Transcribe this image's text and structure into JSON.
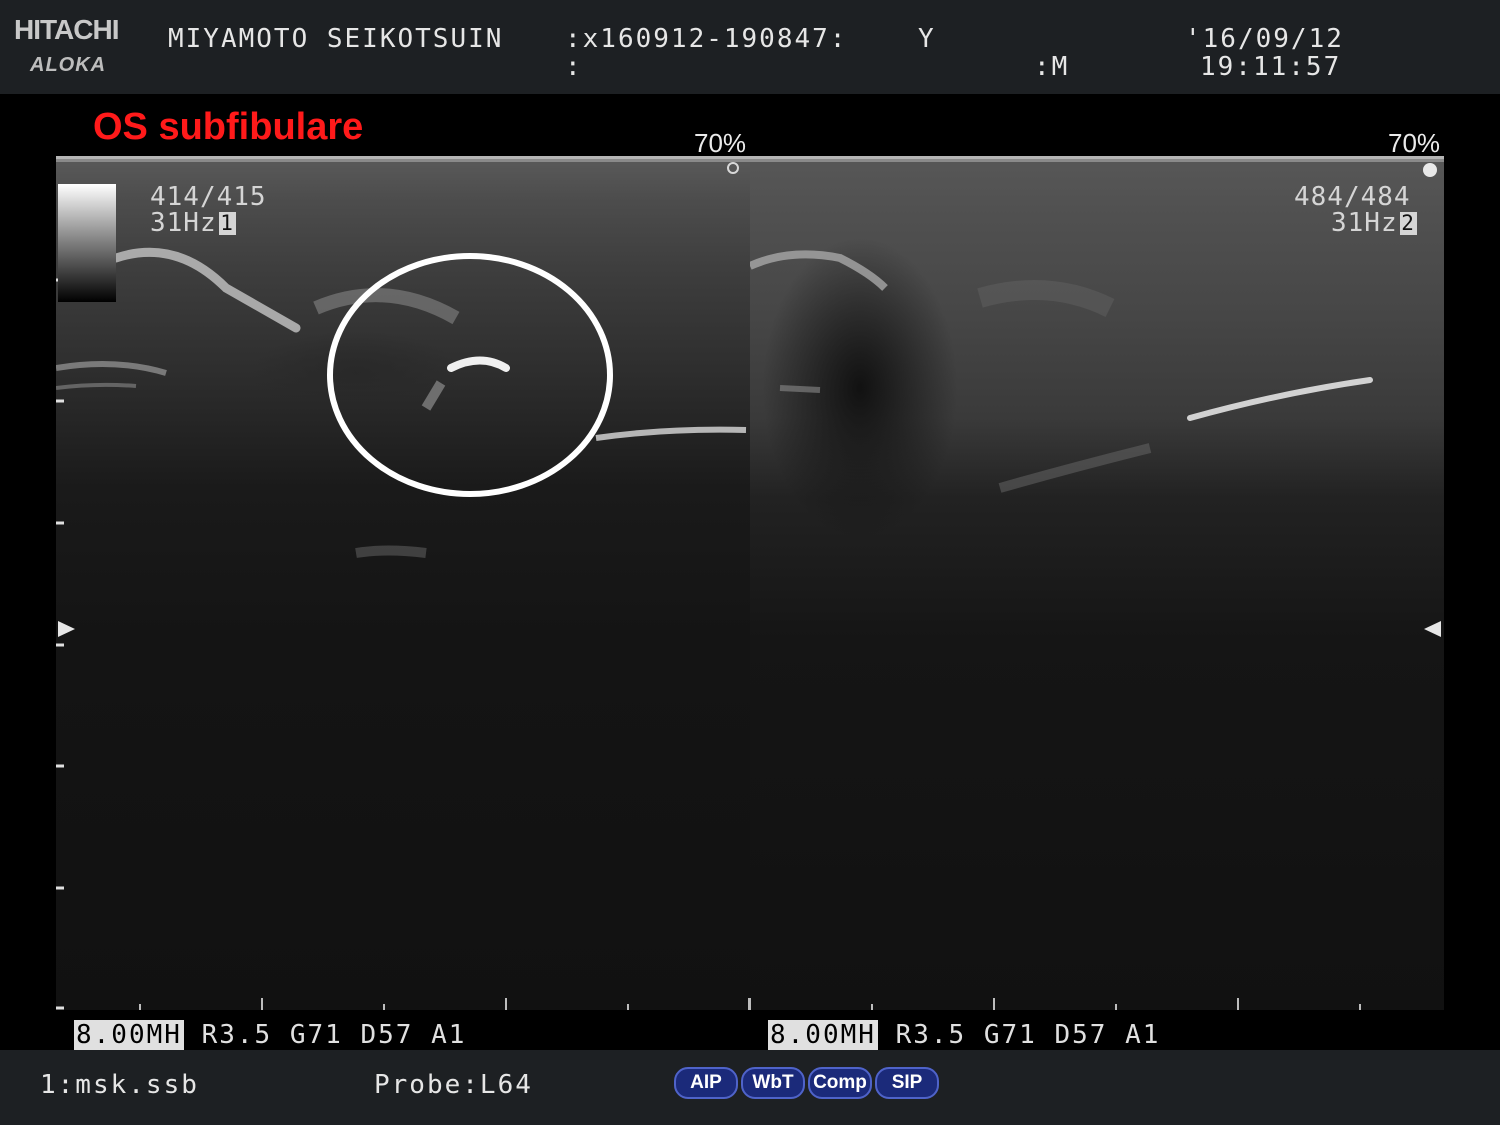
{
  "header": {
    "brand": "HITACHI",
    "sub_brand": "ALOKA",
    "institution": "MIYAMOTO SEIKOTSUIN",
    "patient_id": ":x160912-190847:",
    "line2_colon": ":",
    "age_field": "Y",
    "sex_field": ":M",
    "date": "'16/09/12",
    "time": "19:11:57"
  },
  "annotation": {
    "title": "OS subfibulare"
  },
  "panels": [
    {
      "frame": "414/415",
      "rate": "31Hz",
      "panel_number": "1",
      "gain_percent": "70%"
    },
    {
      "frame": "484/484",
      "rate": "31Hz",
      "panel_number": "2",
      "gain_percent": "70%"
    }
  ],
  "params": {
    "left": {
      "freq": "8.00MH",
      "rest": " R3.5 G71 D57 A1"
    },
    "right": {
      "freq": "8.00MH",
      "rest": " R3.5 G71 D57 A1"
    }
  },
  "footer": {
    "preset": "1:msk.ssb",
    "probe": "Probe:L64",
    "mode_buttons": [
      "AIP",
      "WbT",
      "Comp",
      "SIP"
    ]
  },
  "colors": {
    "annotation_red": "#ff1a1a",
    "header_bg": "#1d2023",
    "button_blue": "#1b2a7a"
  },
  "icons": [
    "focus-marker-icon",
    "depth-marker-left-icon",
    "depth-marker-right-icon"
  ]
}
